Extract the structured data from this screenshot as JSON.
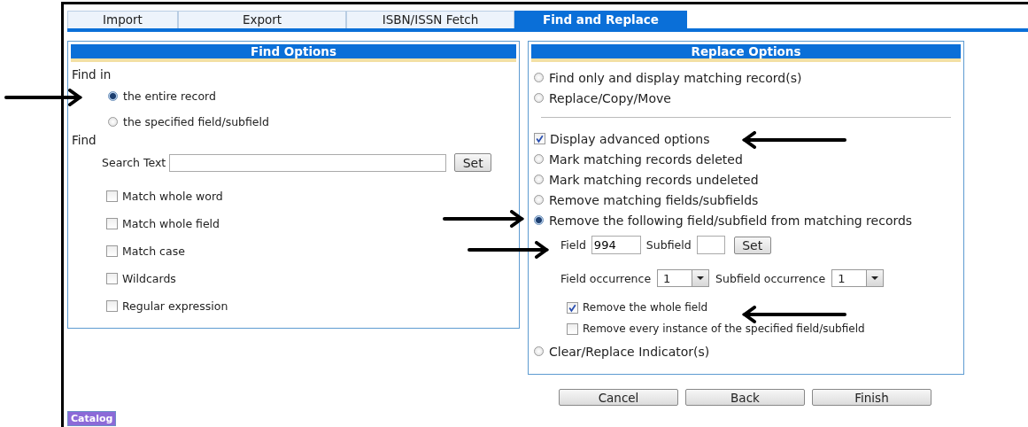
{
  "tabs": [
    {
      "label": "Import",
      "selected": false
    },
    {
      "label": "Export",
      "selected": false
    },
    {
      "label": "ISBN/ISSN Fetch",
      "selected": false
    },
    {
      "label": "Find and Replace",
      "selected": true
    }
  ],
  "find_options": {
    "title": "Find Options",
    "find_in_label": "Find in",
    "find_in": [
      {
        "label": "the entire record",
        "selected": true
      },
      {
        "label": "the specified field/subfield",
        "selected": false
      }
    ],
    "find_label": "Find",
    "search_label": "Search Text",
    "set_button": "Set",
    "checks": [
      {
        "label": "Match whole word",
        "checked": false
      },
      {
        "label": "Match whole field",
        "checked": false
      },
      {
        "label": "Match case",
        "checked": false
      },
      {
        "label": "Wildcards",
        "checked": false
      },
      {
        "label": "Regular expression",
        "checked": false
      }
    ]
  },
  "replace_options": {
    "title": "Replace Options",
    "modes": [
      {
        "label": "Find only and display matching record(s)",
        "selected": false
      },
      {
        "label": "Replace/Copy/Move",
        "selected": false
      }
    ],
    "advanced": {
      "label": "Display advanced options",
      "checked": true
    },
    "actions": [
      {
        "label": "Mark matching records deleted",
        "selected": false
      },
      {
        "label": "Mark matching records undeleted",
        "selected": false
      },
      {
        "label": "Remove matching fields/subfields",
        "selected": false
      },
      {
        "label": "Remove the following field/subfield from matching records",
        "selected": true
      }
    ],
    "field_settings": {
      "field_label": "Field",
      "field_value": "994",
      "subfield_label": "Subfield",
      "set_button": "Set",
      "field_occurrence_label": "Field occurrence",
      "field_occurrence": "1",
      "subfield_occurrence_label": "Subfield occurrence",
      "subfield_occurrence": "1",
      "checks": [
        {
          "label": "Remove the whole field",
          "checked": true
        },
        {
          "label": "Remove every instance of the specified field/subfield",
          "checked": false
        }
      ]
    },
    "last_action": {
      "label": "Clear/Replace Indicator(s)",
      "selected": false
    }
  },
  "buttons": [
    "Cancel",
    "Back",
    "Finish"
  ],
  "module_badge": "Catalog"
}
